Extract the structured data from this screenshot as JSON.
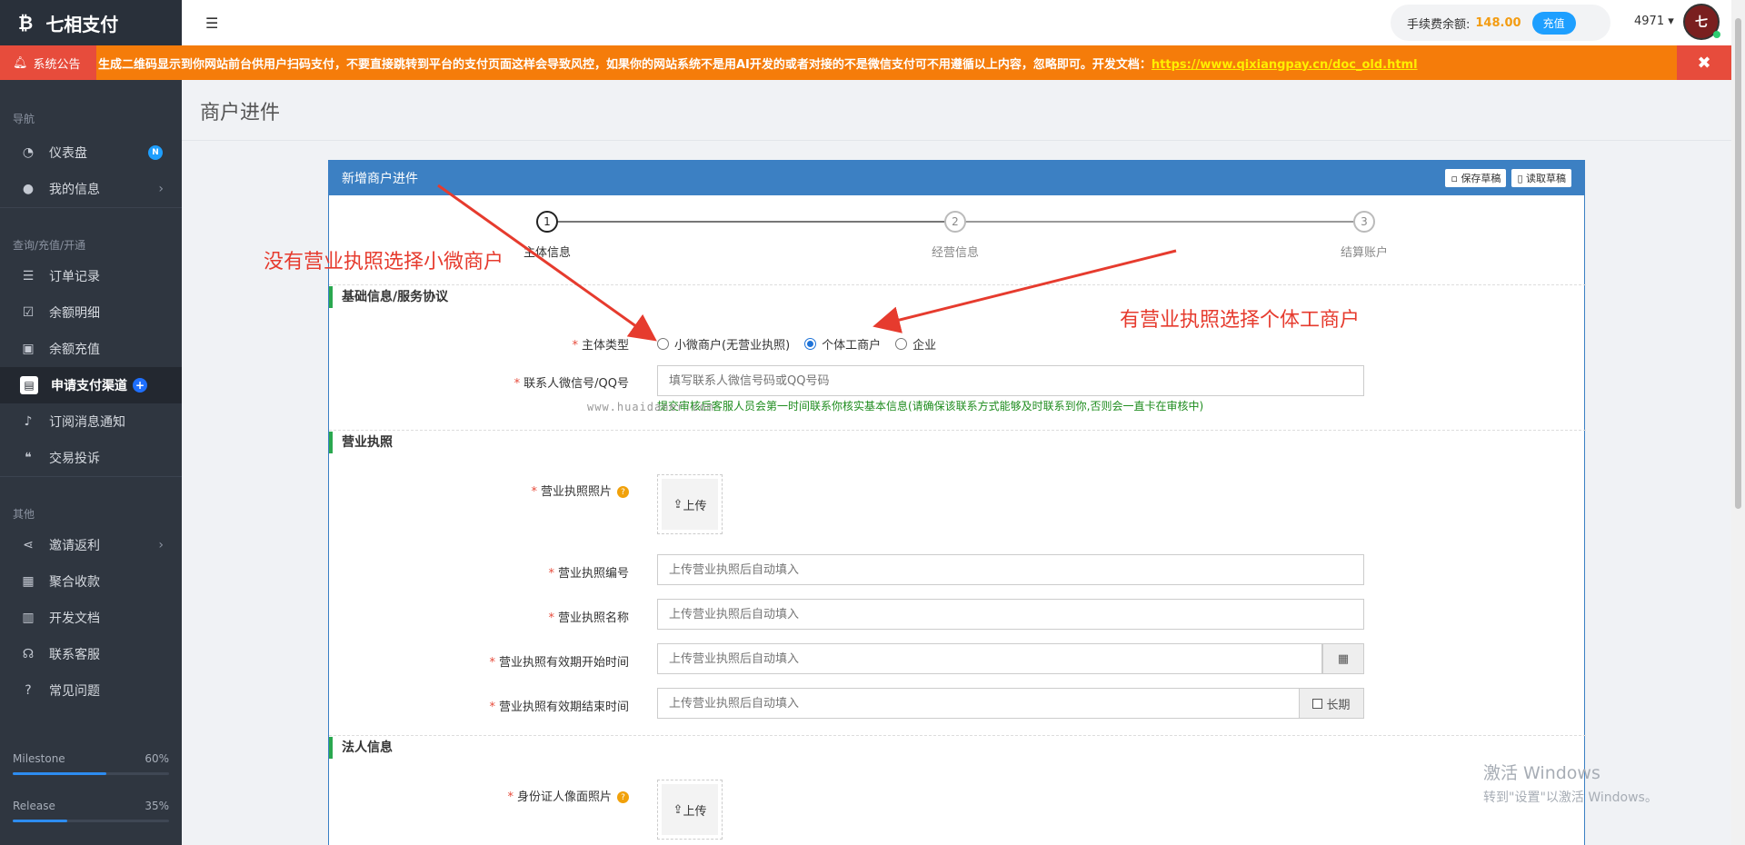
{
  "brand": {
    "logo": "₿",
    "name": "七相支付"
  },
  "sidebar": {
    "sections": [
      "导航",
      "查询/充值/开通",
      "其他"
    ],
    "items": [
      {
        "label": "仪表盘",
        "icon": "dashboard-icon",
        "badge": "N"
      },
      {
        "label": "我的信息",
        "icon": "user-icon"
      },
      {
        "label": "订单记录",
        "icon": "list-icon"
      },
      {
        "label": "余额明细",
        "icon": "calendar-check-icon"
      },
      {
        "label": "余额充值",
        "icon": "money-icon"
      },
      {
        "label": "申请支付渠道",
        "icon": "clipboard-icon",
        "badge": "+"
      },
      {
        "label": "订阅消息通知",
        "icon": "bell-icon"
      },
      {
        "label": "交易投诉",
        "icon": "comments-icon"
      },
      {
        "label": "邀请返利",
        "icon": "share-icon"
      },
      {
        "label": "聚合收款",
        "icon": "qrcode-icon"
      },
      {
        "label": "开发文档",
        "icon": "book-icon"
      },
      {
        "label": "联系客服",
        "icon": "headset-icon"
      },
      {
        "label": "常见问题",
        "icon": "question-icon"
      }
    ],
    "progress": [
      {
        "label": "Milestone",
        "value": "60%",
        "fraction": 0.6
      },
      {
        "label": "Release",
        "value": "35%",
        "fraction": 0.35
      }
    ]
  },
  "topbar": {
    "fee_label": "手续费余额:",
    "fee_value": "148.00",
    "recharge_label": "充值",
    "user_id": "4971 ▾",
    "avatar_text": "七"
  },
  "notice": {
    "label": "系统公告",
    "text": "生成二维码显示到你网站前台供用户扫码支付，不要直接跳转到平台的支付页面这样会导致风控，如果你的网站系统不是用AI开发的或者对接的不是微信支付可不用遵循以上内容，忽略即可。开发文档：",
    "link": "https://www.qixiangpay.cn/doc_old.html",
    "close": "✖"
  },
  "page": {
    "title": "商户进件"
  },
  "panel": {
    "title": "新增商户进件",
    "save_draft": "保存草稿",
    "load_draft": "读取草稿",
    "steps": [
      {
        "num": "1",
        "label": "主体信息"
      },
      {
        "num": "2",
        "label": "经营信息"
      },
      {
        "num": "3",
        "label": "结算账户"
      }
    ],
    "sections": {
      "basic": "基础信息/服务协议",
      "license": "营业执照",
      "legal": "法人信息"
    },
    "fields": {
      "subject_type": {
        "label": "主体类型",
        "options": [
          "小微商户(无营业执照)",
          "个体工商户",
          "企业"
        ],
        "selected": "个体工商户"
      },
      "contact": {
        "label": "联系人微信号/QQ号",
        "placeholder": "填写联系人微信号码或QQ号码",
        "hint": "提交审核后客服人员会第一时间联系你核实基本信息(请确保该联系方式能够及时联系到你,否则会一直卡在审核中)"
      },
      "license_photo": {
        "label": "营业执照照片",
        "upload": "上传"
      },
      "license_no": {
        "label": "营业执照编号",
        "placeholder": "上传营业执照后自动填入"
      },
      "license_name": {
        "label": "营业执照名称",
        "placeholder": "上传营业执照后自动填入"
      },
      "license_start": {
        "label": "营业执照有效期开始时间",
        "placeholder": "上传营业执照后自动填入"
      },
      "license_end": {
        "label": "营业执照有效期结束时间",
        "placeholder": "上传营业执照后自动填入",
        "long_term": "长期"
      },
      "id_front": {
        "label": "身份证人像面照片",
        "upload": "上传"
      }
    },
    "watermark": "www.huaidaner.com"
  },
  "annotations": {
    "left": "没有营业执照选择小微商户",
    "right": "有营业执照选择个体工商户"
  },
  "windows_watermark": {
    "line1": "激活 Windows",
    "line2": "转到\"设置\"以激活 Windows。"
  },
  "colors": {
    "accent": "#3c80c3",
    "notice": "#f57c0a",
    "annotation": "#e63b2e",
    "fee": "#f39c12"
  }
}
